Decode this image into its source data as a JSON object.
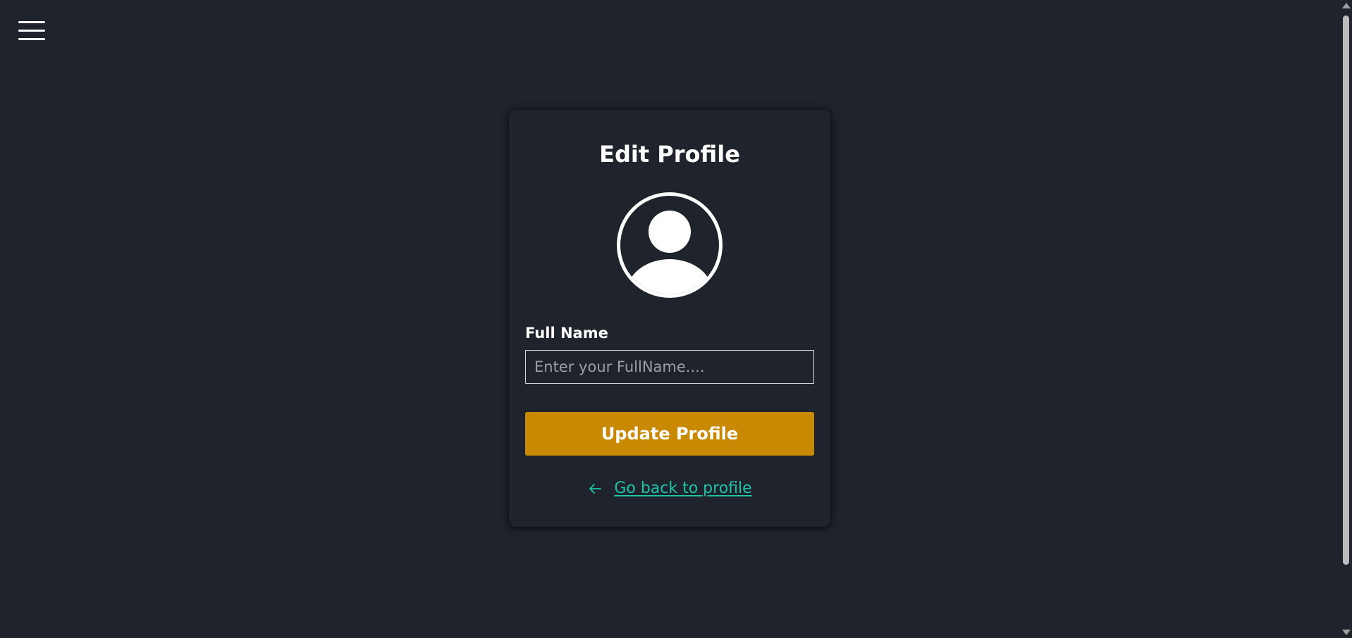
{
  "header": {
    "menu_icon": "hamburger-menu-icon"
  },
  "card": {
    "title": "Edit Profile",
    "avatar_icon": "user-circle-icon",
    "full_name_label": "Full Name",
    "full_name_value": "",
    "full_name_placeholder": "Enter your FullName....",
    "update_button_label": "Update Profile",
    "back_link_icon": "arrow-left-icon",
    "back_link_label": "Go back to profile"
  },
  "colors": {
    "background": "#1f232b",
    "accent_button": "#c98902",
    "link": "#1fc3a8",
    "text": "#ffffff"
  }
}
